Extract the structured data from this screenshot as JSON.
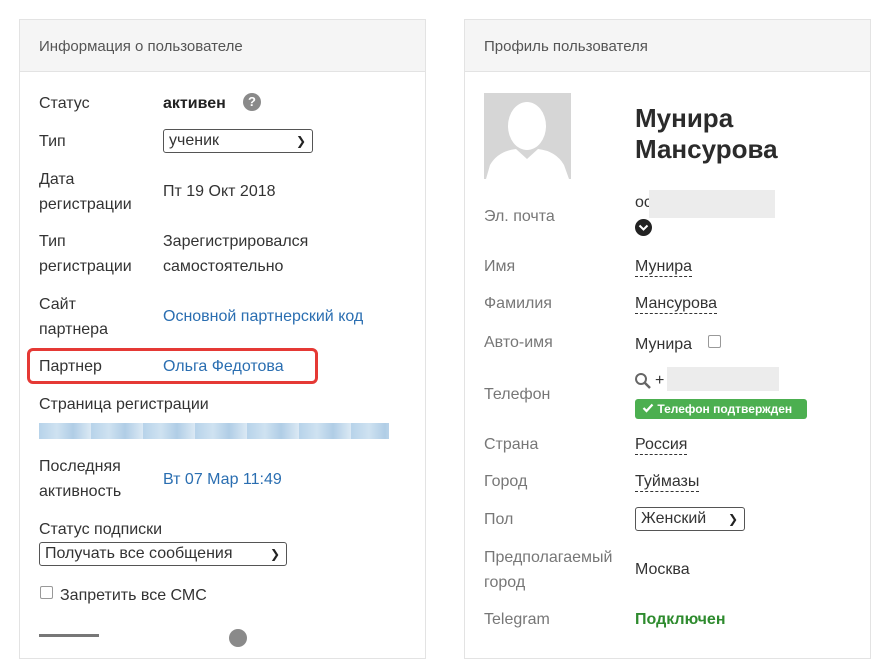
{
  "left_panel": {
    "title": "Информация о пользователе",
    "status_label": "Статус",
    "status_value": "активен",
    "help_glyph": "?",
    "type_label": "Тип",
    "type_select": "ученик",
    "reg_date_label_1": "Дата",
    "reg_date_label_2": "регистрации",
    "reg_date_value": "Пт 19 Окт 2018",
    "reg_type_label_1": "Тип",
    "reg_type_label_2": "регистрации",
    "reg_type_value_1": "Зарегистрировался",
    "reg_type_value_2": "самостоятельно",
    "partner_site_label_1": "Сайт",
    "partner_site_label_2": "партнера",
    "partner_site_value": "Основной партнерский код",
    "partner_label": "Партнер",
    "partner_value": "Ольга Федотова",
    "reg_page_label": "Страница регистрации",
    "last_active_label_1": "Последняя",
    "last_active_label_2": "активность",
    "last_active_value": "Вт 07 Мар 11:49",
    "subscription_label": "Статус подписки",
    "subscription_select": "Получать все сообщения",
    "block_sms_label": "Запретить все СМС"
  },
  "right_panel": {
    "title": "Профиль пользователя",
    "first_name_heading": "Мунира",
    "last_name_heading": "Мансурова",
    "email_label": "Эл. почта",
    "email_value_visible": "ос",
    "name_label": "Имя",
    "name_value": "Мунира",
    "surname_label": "Фамилия",
    "surname_value": "Мансурова",
    "auto_name_label": "Авто-имя",
    "auto_name_value": "Мунира",
    "phone_label": "Телефон",
    "phone_prefix": "+",
    "phone_badge": "Телефон подтвержден",
    "country_label": "Страна",
    "country_value": "Россия",
    "city_label": "Город",
    "city_value": "Туймазы",
    "gender_label": "Пол",
    "gender_select": "Женский",
    "assumed_city_label_1": "Предполагаемый",
    "assumed_city_label_2": "город",
    "assumed_city_value": "Москва",
    "telegram_label": "Telegram",
    "telegram_value": "Подключен"
  },
  "colors": {
    "link": "#2a6eb1",
    "highlight": "#e53935",
    "badge": "#4caf50",
    "connected": "#2e8b2e"
  },
  "icons": [
    "help-icon",
    "chevron-down-icon",
    "search-icon",
    "check-icon",
    "avatar-silhouette-icon"
  ]
}
